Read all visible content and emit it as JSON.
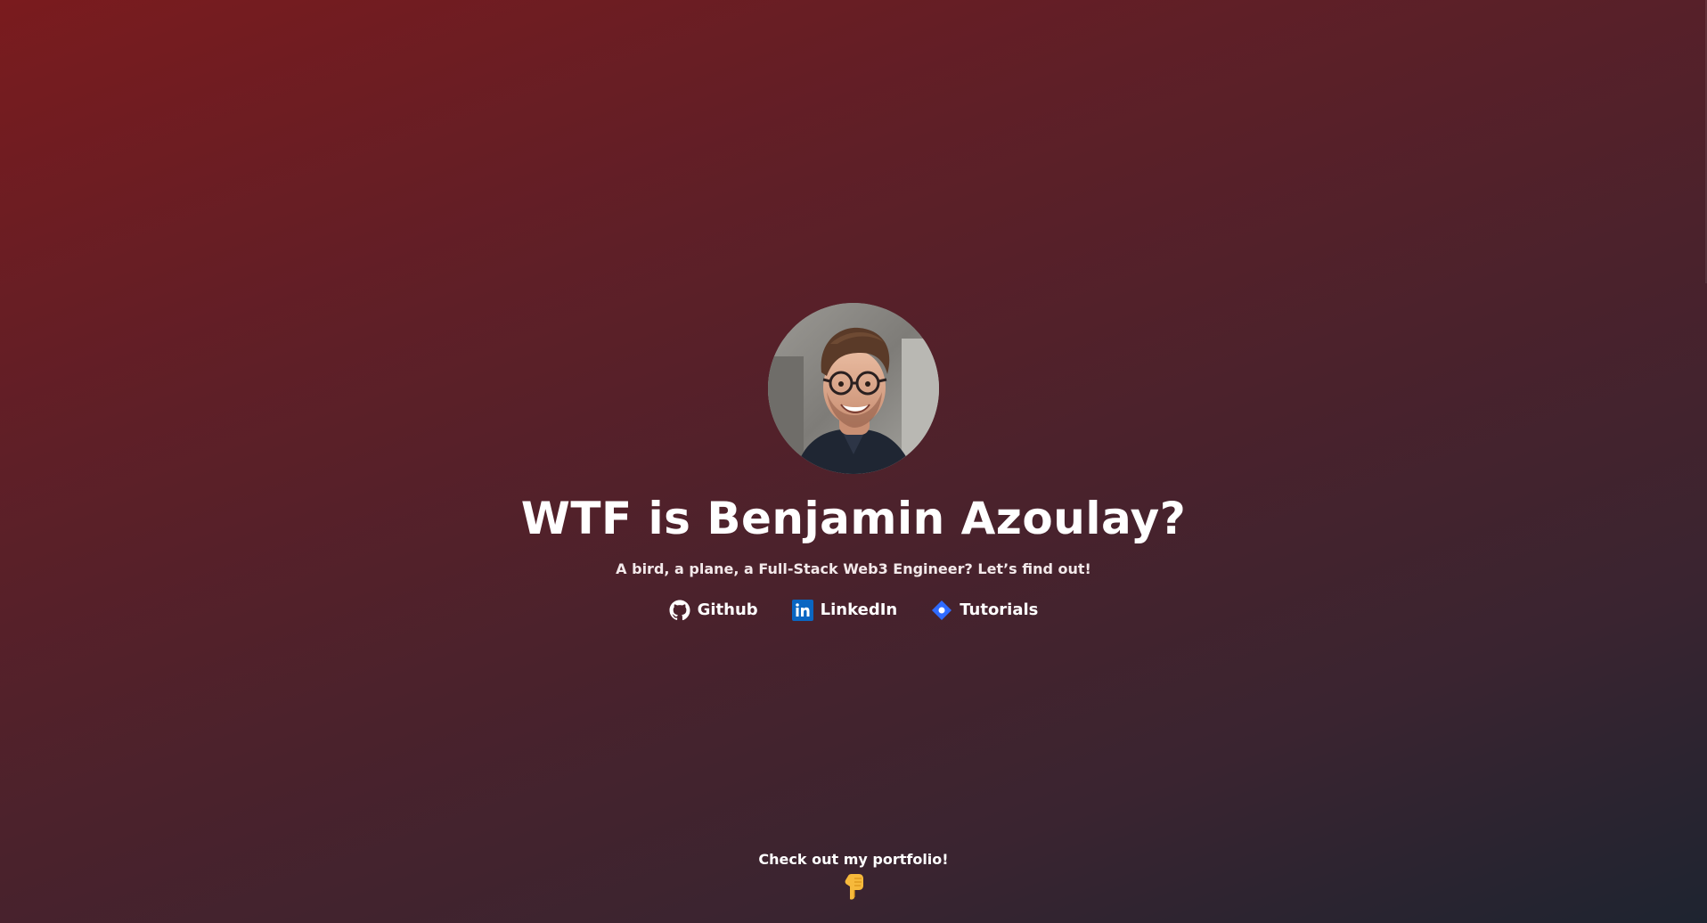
{
  "hero": {
    "avatar_alt": "Benjamin Azoulay",
    "title": "WTF is Benjamin Azoulay?",
    "subtitle": "A bird, a plane, a Full-Stack Web3 Engineer? Let’s find out!"
  },
  "links": [
    {
      "label": "Github",
      "icon": "github-icon"
    },
    {
      "label": "LinkedIn",
      "icon": "linkedin-icon"
    },
    {
      "label": "Tutorials",
      "icon": "tutorials-icon"
    }
  ],
  "portfolio": {
    "label": "Check out my portfolio!",
    "icon": "pointing-down-hand-icon"
  },
  "colors": {
    "background_start": "#7a1b1e",
    "background_end": "#1e2430",
    "text": "#ffffff",
    "linkedin_blue": "#0a66c2",
    "tutorials_blue": "#2f6bff",
    "pointer_yellow": "#f6b93b"
  }
}
